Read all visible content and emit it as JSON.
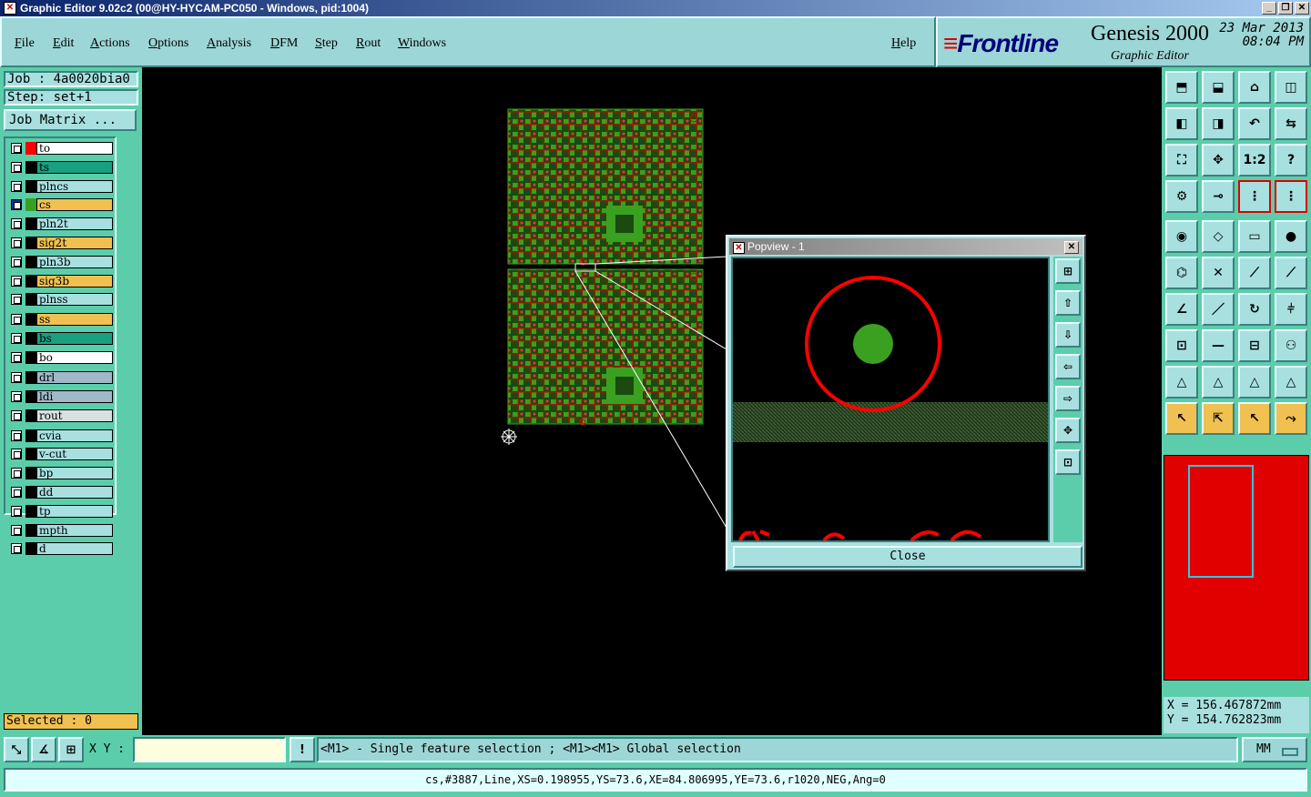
{
  "window": {
    "title": "Graphic Editor 9.02c2 (00@HY-HYCAM-PC050 - Windows, pid:1004)"
  },
  "menu": [
    "File",
    "Edit",
    "Actions",
    "Options",
    "Analysis",
    "DFM",
    "Step",
    "Rout",
    "Windows"
  ],
  "help_label": "Help",
  "brand": {
    "logo": "Frontline",
    "product": "Genesis 2000",
    "subtitle": "Graphic Editor",
    "date": "23 Mar 2013",
    "time": "08:04 PM"
  },
  "job": {
    "job_label": "Job : 4a0020bia0",
    "step_label": "Step: set+1",
    "matrix_button": "Job Matrix ..."
  },
  "layers": [
    {
      "name": "to",
      "color": "#ffffff",
      "swatch": "#ff0000"
    },
    {
      "name": "ts",
      "color": "#1aa080",
      "swatch": "#000000"
    },
    {
      "name": "plncs",
      "color": "#a8e0e0",
      "swatch": "#000000"
    },
    {
      "name": "cs",
      "color": "#f0c050",
      "swatch": "#3aa020",
      "active": true
    },
    {
      "name": "pln2t",
      "color": "#a8e0e0",
      "swatch": "#000000"
    },
    {
      "name": "sig2t",
      "color": "#f0c050",
      "swatch": "#000000"
    },
    {
      "name": "pln3b",
      "color": "#a8e0e0",
      "swatch": "#000000"
    },
    {
      "name": "sig3b",
      "color": "#f0c050",
      "swatch": "#000000"
    },
    {
      "name": "plnss",
      "color": "#a8e0e0",
      "swatch": "#000000"
    },
    {
      "name": "ss",
      "color": "#f0c050",
      "swatch": "#000000"
    },
    {
      "name": "bs",
      "color": "#1aa080",
      "swatch": "#000000"
    },
    {
      "name": "bo",
      "color": "#ffffff",
      "swatch": "#000000"
    },
    {
      "name": "drl",
      "color": "#a0b8c8",
      "swatch": "#000000"
    },
    {
      "name": "ldi",
      "color": "#a0b8c8",
      "swatch": "#000000"
    },
    {
      "name": "rout",
      "color": "#d8e0e0",
      "swatch": "#000000"
    },
    {
      "name": "cvia",
      "color": "#a8e0e0",
      "swatch": "#000000"
    },
    {
      "name": "v-cut",
      "color": "#a8e0e0",
      "swatch": "#000000"
    },
    {
      "name": "bp",
      "color": "#a8e0e0",
      "swatch": "#000000"
    },
    {
      "name": "dd",
      "color": "#a8e0e0",
      "swatch": "#000000"
    },
    {
      "name": "tp",
      "color": "#a8e0e0",
      "swatch": "#000000"
    },
    {
      "name": "mpth",
      "color": "#a8e0e0",
      "swatch": "#000000"
    },
    {
      "name": "d",
      "color": "#a8e0e0",
      "swatch": "#000000"
    }
  ],
  "selected_label": "Selected : 0",
  "popview": {
    "title": "Popview - 1",
    "close_label": "Close"
  },
  "coords": {
    "x_label": "X = 156.467872mm",
    "y_label": "Y = 154.762823mm"
  },
  "bottom": {
    "xy_label": "X Y :",
    "xy_value": "",
    "hint": "<M1> - Single feature selection ; <M1><M1> Global selection",
    "units": "MM"
  },
  "status": "cs,#3887,Line,XS=0.198955,YS=73.6,XE=84.806995,YE=73.6,r1020,NEG,Ang=0",
  "colors": {
    "background": "#000000",
    "panel": "#5ccdaa",
    "board_green": "#3aa020",
    "feature_red": "#ff0000",
    "minimap": "#e00000"
  }
}
